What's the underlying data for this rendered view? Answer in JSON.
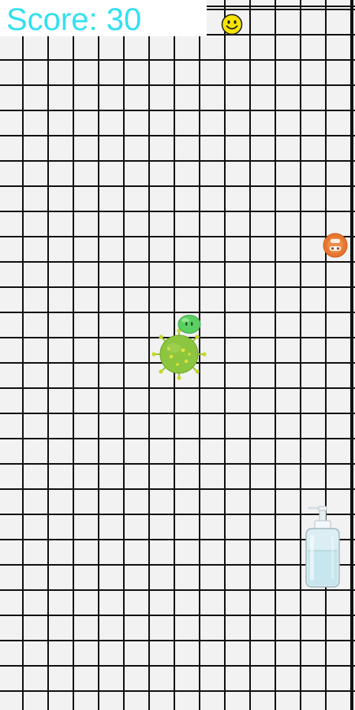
{
  "hud": {
    "score_text": "Score: 30",
    "score_color": "#33e0f0"
  },
  "board": {
    "background": "#f2f2f2",
    "grid_line_color": "#111111"
  },
  "sprites": [
    {
      "name": "smiley-coin",
      "icon": "smiley-face-icon",
      "color": "#f7e400"
    },
    {
      "name": "orange-bonus",
      "icon": "orange-face-icon",
      "color": "#e8762f"
    },
    {
      "name": "virus-enemy",
      "icon": "coronavirus-icon",
      "color": "#8cc63f"
    },
    {
      "name": "player-blob",
      "icon": "green-blob-icon",
      "color": "#5ccf62"
    },
    {
      "name": "hand-sanitizer",
      "icon": "sanitizer-bottle-icon",
      "color": "#c8e6ec"
    }
  ]
}
